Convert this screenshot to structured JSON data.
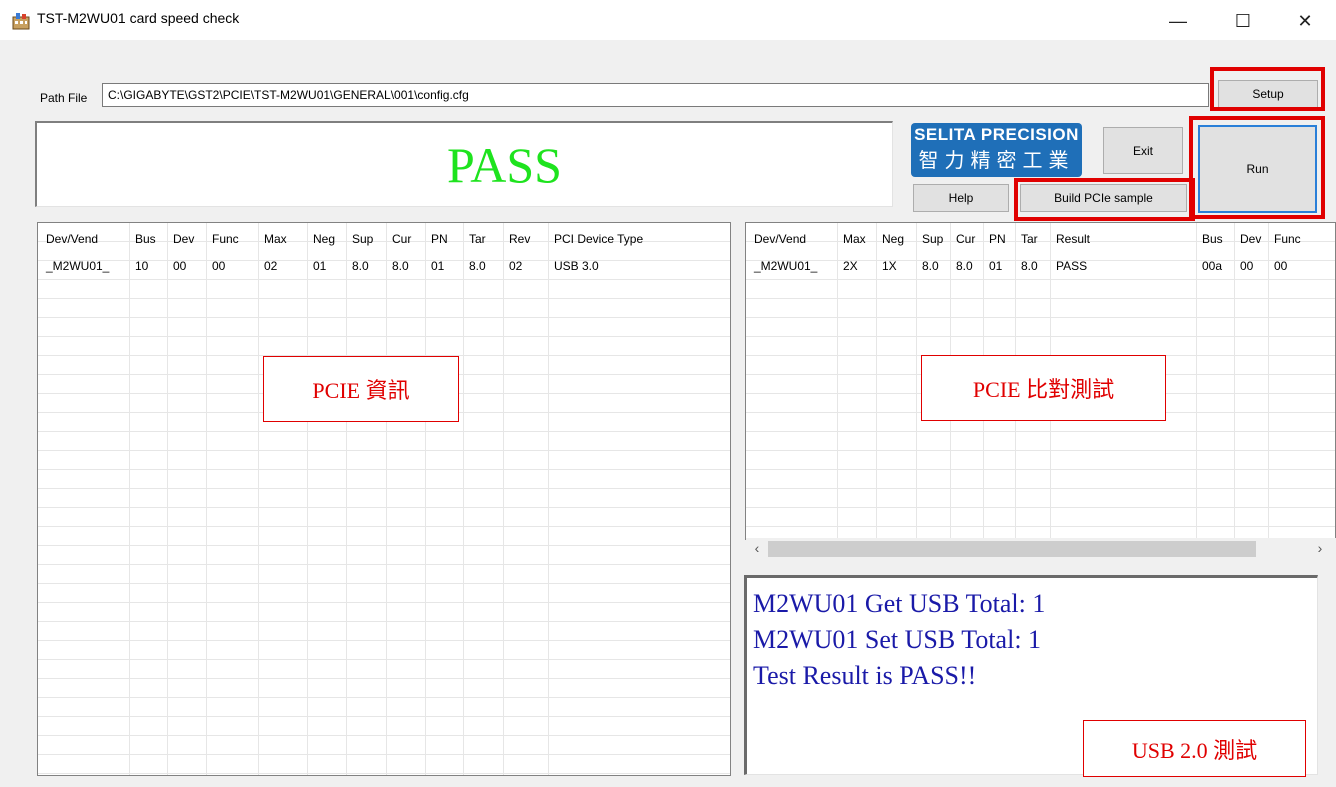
{
  "window": {
    "title": "TST-M2WU01 card speed check",
    "controls": {
      "minimize": "—",
      "maximize": "☐",
      "close": "✕"
    }
  },
  "path": {
    "label": "Path File",
    "value": "C:\\GIGABYTE\\GST2\\PCIE\\TST-M2WU01\\GENERAL\\001\\config.cfg"
  },
  "buttons": {
    "setup": "Setup",
    "exit": "Exit",
    "run": "Run",
    "help": "Help",
    "build": "Build PCIe sample"
  },
  "result": {
    "text": "PASS",
    "color": "#1ee31e"
  },
  "logo": {
    "line1": "SELITA PRECISION",
    "line2": "智力精密工業",
    "color": "#1f6fb8"
  },
  "left_table": {
    "columns": [
      "Dev/Vend",
      "Bus",
      "Dev",
      "Func",
      "Max",
      "Neg",
      "Sup",
      "Cur",
      "PN",
      "Tar",
      "Rev",
      "PCI Device Type"
    ],
    "rows": [
      [
        "_M2WU01_",
        "10",
        "00",
        "00",
        "02",
        "01",
        "8.0",
        "8.0",
        "01",
        "8.0",
        "02",
        "USB 3.0"
      ]
    ]
  },
  "right_table": {
    "columns": [
      "Dev/Vend",
      "Max",
      "Neg",
      "Sup",
      "Cur",
      "PN",
      "Tar",
      "Result",
      "Bus",
      "Dev",
      "Func"
    ],
    "rows": [
      [
        "_M2WU01_",
        "2X",
        "1X",
        "8.0",
        "8.0",
        "01",
        "8.0",
        "PASS",
        "00a",
        "00",
        "00"
      ]
    ]
  },
  "scrollbar": {
    "left_arrow": "‹",
    "right_arrow": "›"
  },
  "log": {
    "lines": [
      "M2WU01 Get USB Total: 1",
      "M2WU01 Set USB Total: 1",
      "Test Result is PASS!!"
    ],
    "color": "#1a1aa8"
  },
  "annotations": {
    "pcie_info": "PCIE 資訊",
    "pcie_compare": "PCIE 比對測試",
    "usb_test": "USB 2.0 測試",
    "color": "#e00000"
  }
}
